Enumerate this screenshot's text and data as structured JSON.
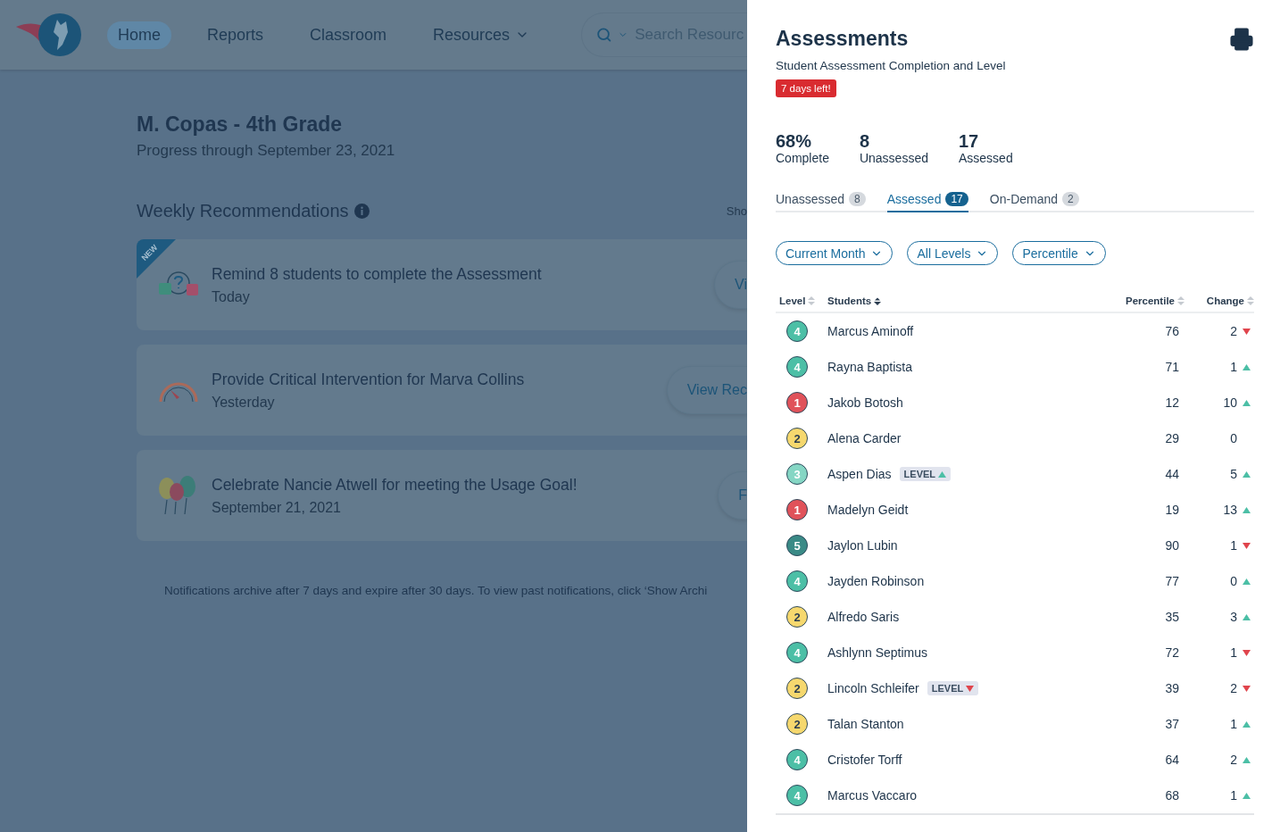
{
  "nav": {
    "items": [
      {
        "label": "Home",
        "selected": true
      },
      {
        "label": "Reports",
        "selected": false
      },
      {
        "label": "Classroom",
        "selected": false
      },
      {
        "label": "Resources",
        "selected": false,
        "dropdown": true
      }
    ],
    "search": {
      "placeholder": "Search Resourc"
    }
  },
  "page": {
    "title": "M. Copas - 4th Grade",
    "subtitle": "Progress through September 23, 2021",
    "section_title": "Weekly Recommendations",
    "archive_link": "Sho",
    "cards": [
      {
        "kind": "assessment",
        "new_label": "NEW",
        "title": "Remind 8 students to complete the Assessment",
        "date": "Today",
        "button": "Vi"
      },
      {
        "kind": "gauge",
        "title": "Provide Critical Intervention for Marva Collins",
        "date": "Yesterday",
        "button": "View Rec"
      },
      {
        "kind": "balloons",
        "title": "Celebrate Nancie Atwell for meeting the Usage Goal!",
        "date": "September 21, 2021",
        "button": "F"
      }
    ],
    "footnote": "Notifications archive after 7 days and expire after 30 days. To view past notifications, click ‘Show Archi"
  },
  "drawer": {
    "title": "Assessments",
    "subtitle": "Student Assessment Completion and Level",
    "deadline_badge": "7 days left!",
    "stats": [
      {
        "value": "68%",
        "label": "Complete"
      },
      {
        "value": "8",
        "label": "Unassessed"
      },
      {
        "value": "17",
        "label": "Assessed"
      }
    ],
    "tabs": [
      {
        "label": "Unassessed",
        "count": "8",
        "selected": false
      },
      {
        "label": "Assessed",
        "count": "17",
        "selected": true
      },
      {
        "label": "On-Demand",
        "count": "2",
        "selected": false
      }
    ],
    "filters": [
      "Current Month",
      "All Levels",
      "Percentile"
    ],
    "table": {
      "columns": [
        {
          "label": "Level",
          "sorted": false
        },
        {
          "label": "Students",
          "sorted": true
        },
        {
          "label": "Percentile",
          "sorted": false
        },
        {
          "label": "Change",
          "sorted": false
        }
      ],
      "rows": [
        {
          "level": "4",
          "color": "#4cbfa6",
          "name": "Marcus Aminoff",
          "percentile": "76",
          "change": "2",
          "up": false,
          "down": true
        },
        {
          "level": "4",
          "color": "#4cbfa6",
          "name": "Rayna Baptista",
          "percentile": "71",
          "change": "1",
          "up": true,
          "down": false
        },
        {
          "level": "1",
          "color": "#e0525a",
          "name": "Jakob Botosh",
          "percentile": "12",
          "change": "10",
          "up": true,
          "down": false
        },
        {
          "level": "2",
          "color": "#f6d86e",
          "name": "Alena Carder",
          "percentile": "29",
          "change": "0",
          "up": false,
          "down": false
        },
        {
          "level": "3",
          "color": "#85d6c4",
          "name": "Aspen Dias",
          "badge": {
            "label": "LEVEL",
            "up": true
          },
          "percentile": "44",
          "change": "5",
          "up": true,
          "down": false
        },
        {
          "level": "1",
          "color": "#e0525a",
          "name": "Madelyn Geidt",
          "percentile": "19",
          "change": "13",
          "up": true,
          "down": false
        },
        {
          "level": "5",
          "color": "#3a8a86",
          "name": "Jaylon Lubin",
          "percentile": "90",
          "change": "1",
          "up": false,
          "down": true
        },
        {
          "level": "4",
          "color": "#4cbfa6",
          "name": "Jayden Robinson",
          "percentile": "77",
          "change": "0",
          "up": true,
          "down": false
        },
        {
          "level": "2",
          "color": "#f6d86e",
          "name": "Alfredo Saris",
          "percentile": "35",
          "change": "3",
          "up": true,
          "down": false
        },
        {
          "level": "4",
          "color": "#4cbfa6",
          "name": "Ashlynn Septimus",
          "percentile": "72",
          "change": "1",
          "up": false,
          "down": true
        },
        {
          "level": "2",
          "color": "#f6d86e",
          "name": "Lincoln Schleifer",
          "badge": {
            "label": "LEVEL",
            "up": false
          },
          "percentile": "39",
          "change": "2",
          "up": false,
          "down": true
        },
        {
          "level": "2",
          "color": "#f6d86e",
          "name": "Talan Stanton",
          "percentile": "37",
          "change": "1",
          "up": true,
          "down": false
        },
        {
          "level": "4",
          "color": "#4cbfa6",
          "name": "Cristofer Torff",
          "percentile": "64",
          "change": "2",
          "up": true,
          "down": false
        },
        {
          "level": "4",
          "color": "#4cbfa6",
          "name": "Marcus Vaccaro",
          "percentile": "68",
          "change": "1",
          "up": true,
          "down": false
        }
      ]
    }
  }
}
